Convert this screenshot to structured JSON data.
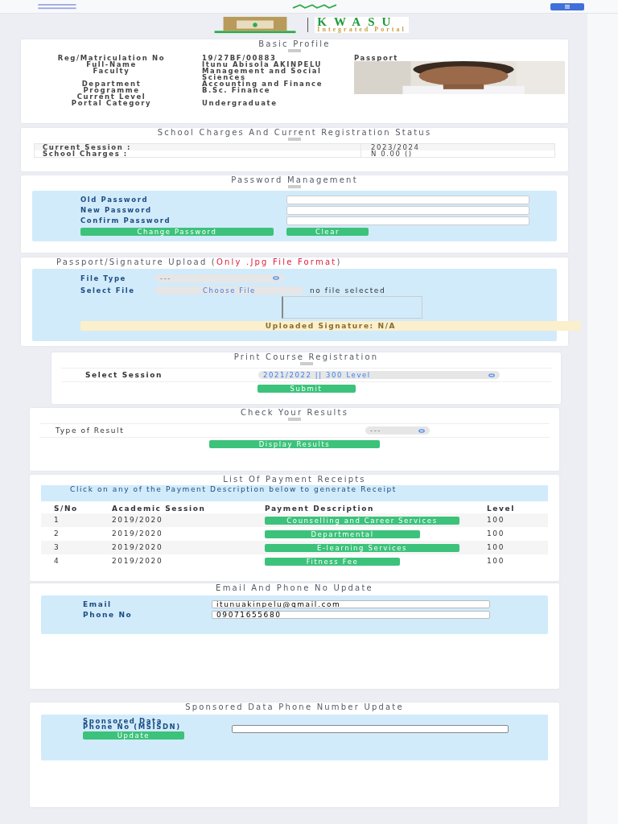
{
  "header": {
    "logo_title": "KWASU",
    "logo_subtitle": "Integrated Portal"
  },
  "basic_profile": {
    "title": "Basic Profile",
    "passport_label": "Passport",
    "fields": [
      {
        "label": "Reg/Matriculation No",
        "value": "19/27BF/00883"
      },
      {
        "label": "Full-Name",
        "value": "Itunu Abisola AKINPELU"
      },
      {
        "label": "Faculty",
        "value": "Management and Social Sciences"
      },
      {
        "label": "Department",
        "value": "Accounting and Finance"
      },
      {
        "label": "Programme",
        "value": "B.Sc. Finance"
      },
      {
        "label": "Current Level"
      },
      {
        "label": "Portal Category",
        "value": "Undergraduate"
      }
    ]
  },
  "school_charges": {
    "title": "School Charges And Current Registration Status",
    "rows": [
      {
        "label": "Current Session :",
        "value": "2023/2024"
      },
      {
        "label": "School Charges :",
        "value": "N 0.00 ()"
      }
    ]
  },
  "password": {
    "title": "Password Management",
    "fields": [
      {
        "label": "Old Password"
      },
      {
        "label": "New Password"
      },
      {
        "label": "Confirm Password"
      }
    ],
    "buttons": [
      "Change Password",
      "Clear"
    ]
  },
  "upload": {
    "title": "Passport/Signature Upload (",
    "note": "Only .Jpg File Format",
    "title_end": ")",
    "file_type_label": "File Type",
    "file_type_value": "---",
    "select_file_label": "Select File",
    "choose_button": "Choose File",
    "no_file": "no file selected",
    "signature_status": "Uploaded Signature: N/A"
  },
  "print_course": {
    "title": "Print Course Registration",
    "label": "Select Session",
    "select_value": "2021/2022 || 300 Level",
    "button": "Submit"
  },
  "results": {
    "title": "Check Your Results",
    "label": "Type of Result",
    "select_value": "---",
    "button": "Display Results"
  },
  "receipts": {
    "title": "List Of Payment Receipts",
    "info": "Click on any of the Payment Description below to generate Receipt",
    "columns": [
      "S/No",
      "Academic Session",
      "Payment Description",
      "Level"
    ],
    "rows": [
      {
        "sn": "1",
        "session": "2019/2020",
        "description": "Counselling and Career Services",
        "level": "100"
      },
      {
        "sn": "2",
        "session": "2019/2020",
        "description": "Departmental",
        "level": "100"
      },
      {
        "sn": "3",
        "session": "2019/2020",
        "description": "E-learning Services",
        "level": "100"
      },
      {
        "sn": "4",
        "session": "2019/2020",
        "description": "Fitness Fee",
        "level": "100"
      }
    ]
  },
  "contact": {
    "title": "Email And Phone No Update",
    "fields": [
      {
        "label": "Email",
        "value": "itunuakinpelu@gmail.com"
      },
      {
        "label": "Phone No",
        "value": "09071655680"
      }
    ]
  },
  "sponsored": {
    "title": "Sponsored Data Phone Number Update",
    "label": "Sponsored Data Phone No (MSISDN)",
    "button": "Update"
  }
}
